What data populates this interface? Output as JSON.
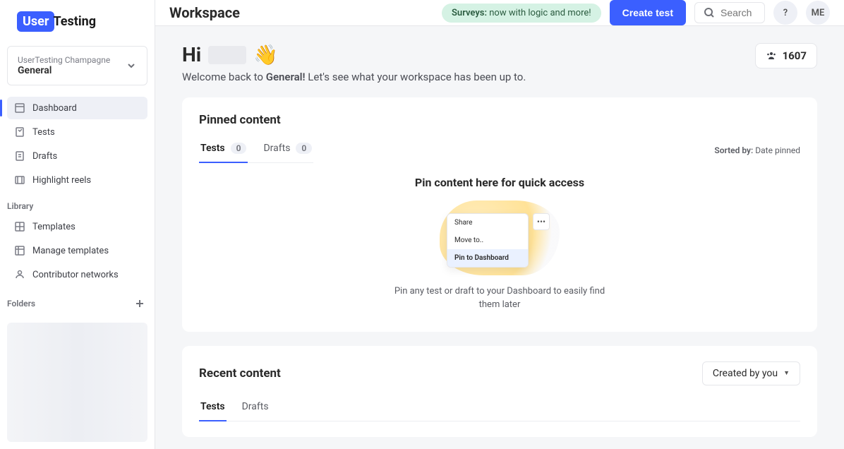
{
  "logo": {
    "badge": "User",
    "rest": "Testing"
  },
  "workspace": {
    "org": "UserTesting Champagne",
    "name": "General"
  },
  "nav": {
    "items": [
      {
        "label": "Dashboard",
        "active": true
      },
      {
        "label": "Tests"
      },
      {
        "label": "Drafts"
      },
      {
        "label": "Highlight reels"
      }
    ],
    "librarySection": "Library",
    "library": [
      {
        "label": "Templates"
      },
      {
        "label": "Manage templates"
      },
      {
        "label": "Contributor networks"
      }
    ],
    "foldersSection": "Folders"
  },
  "topbar": {
    "title": "Workspace",
    "announcePrefix": "Surveys:",
    "announceRest": " now with logic and more!",
    "createLabel": "Create test",
    "searchPlaceholder": "Search",
    "help": "?",
    "avatar": "ME"
  },
  "greeting": {
    "hi": "Hi",
    "wave": "👋",
    "welcomePrefix": "Welcome back to ",
    "workspaceName": "General!",
    "welcomeSuffix": " Let's see what your workspace has been up to."
  },
  "countPill": {
    "value": "1607"
  },
  "pinned": {
    "title": "Pinned content",
    "tabs": {
      "tests": "Tests",
      "testsCount": "0",
      "drafts": "Drafts",
      "draftsCount": "0"
    },
    "sortedLabel": "Sorted by:",
    "sortedValue": "Date pinned",
    "emptyHeading": "Pin content here for quick access",
    "menu": {
      "share": "Share",
      "moveTo": "Move to..",
      "pin": "Pin to Dashboard"
    },
    "dots": "•••",
    "caption": "Pin any test or draft to your Dashboard to easily find them later"
  },
  "recent": {
    "title": "Recent content",
    "filterLabel": "Created by you",
    "tabs": {
      "tests": "Tests",
      "drafts": "Drafts"
    }
  }
}
